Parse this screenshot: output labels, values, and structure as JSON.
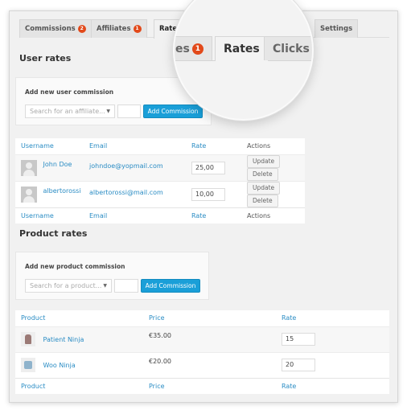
{
  "tabs": [
    {
      "label": "Commissions",
      "badge": "2"
    },
    {
      "label": "Affiliates",
      "badge": "1"
    },
    {
      "label": "Rates",
      "badge": null,
      "active": true
    },
    {
      "label": "Settings",
      "badge": null
    }
  ],
  "magnifier": {
    "tabs": [
      {
        "label": "es",
        "badge": "1"
      },
      {
        "label": "Rates",
        "active": true
      },
      {
        "label": "Clicks"
      }
    ]
  },
  "user_rates": {
    "title": "User rates",
    "add_box": {
      "label": "Add new user commission",
      "search_placeholder": "Search for an affiliate...",
      "rate_value": "",
      "button": "Add Commission"
    },
    "columns": [
      "Username",
      "Email",
      "Rate",
      "Actions"
    ],
    "rows": [
      {
        "username": "John Doe",
        "email": "johndoe@yopmail.com",
        "rate": "25,00"
      },
      {
        "username": "albertorossi",
        "email": "albertorossi@mail.com",
        "rate": "10,00"
      }
    ],
    "update_label": "Update",
    "delete_label": "Delete"
  },
  "product_rates": {
    "title": "Product rates",
    "add_box": {
      "label": "Add new product commission",
      "search_placeholder": "Search for a product...",
      "rate_value": "",
      "button": "Add Commission"
    },
    "columns": [
      "Product",
      "Price",
      "Rate"
    ],
    "rows": [
      {
        "product": "Patient Ninja",
        "price": "€35.00",
        "rate": "15",
        "thumb": "hoodie"
      },
      {
        "product": "Woo Ninja",
        "price": "€20.00",
        "rate": "20",
        "thumb": "tshirt"
      }
    ]
  },
  "colors": {
    "accent": "#1a9fd8",
    "link": "#2a8cc4",
    "badge": "#e2491a"
  }
}
